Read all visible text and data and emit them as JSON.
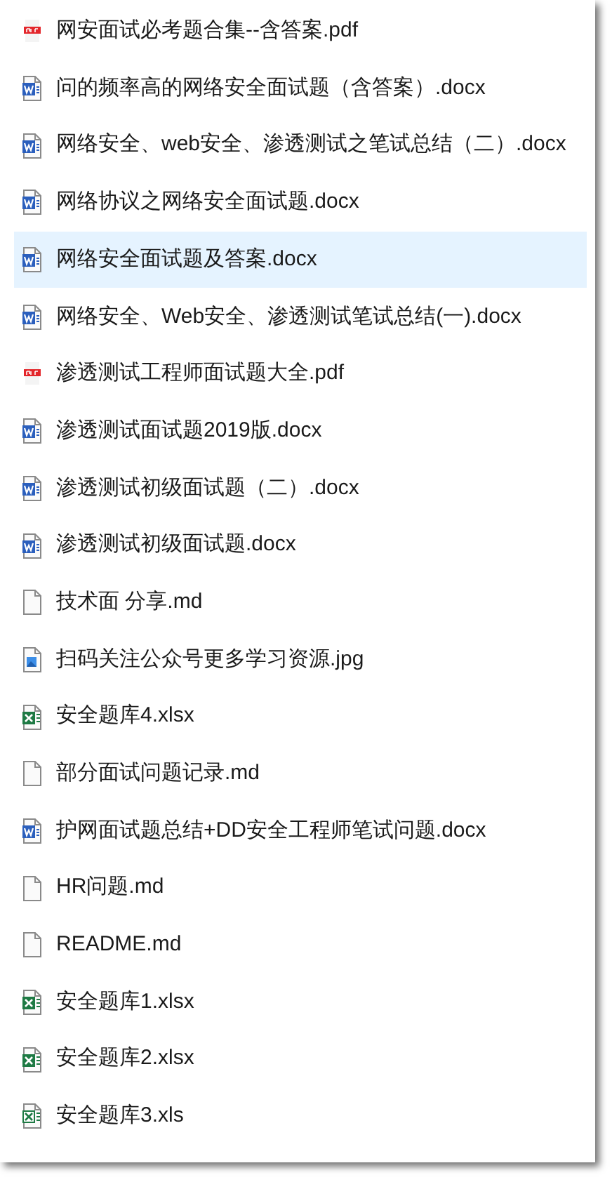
{
  "files": [
    {
      "name": "网安面试必考题合集--含答案.pdf",
      "kind": "pdf",
      "selected": false
    },
    {
      "name": "问的频率高的网络安全面试题（含答案）.docx",
      "kind": "word",
      "selected": false
    },
    {
      "name": "网络安全、web安全、渗透测试之笔试总结（二）.docx",
      "kind": "word",
      "selected": false
    },
    {
      "name": "网络协议之网络安全面试题.docx",
      "kind": "word",
      "selected": false
    },
    {
      "name": "网络安全面试题及答案.docx",
      "kind": "word",
      "selected": true
    },
    {
      "name": "网络安全、Web安全、渗透测试笔试总结(一).docx",
      "kind": "word",
      "selected": false
    },
    {
      "name": "渗透测试工程师面试题大全.pdf",
      "kind": "pdf",
      "selected": false
    },
    {
      "name": "渗透测试面试题2019版.docx",
      "kind": "word",
      "selected": false
    },
    {
      "name": "渗透测试初级面试题（二）.docx",
      "kind": "word",
      "selected": false
    },
    {
      "name": "渗透测试初级面试题.docx",
      "kind": "word",
      "selected": false
    },
    {
      "name": "技术面 分享.md",
      "kind": "text",
      "selected": false
    },
    {
      "name": "扫码关注公众号更多学习资源.jpg",
      "kind": "image",
      "selected": false
    },
    {
      "name": "安全题库4.xlsx",
      "kind": "excel",
      "selected": false
    },
    {
      "name": "部分面试问题记录.md",
      "kind": "text",
      "selected": false
    },
    {
      "name": "护网面试题总结+DD安全工程师笔试问题.docx",
      "kind": "word",
      "selected": false
    },
    {
      "name": "HR问题.md",
      "kind": "text",
      "selected": false
    },
    {
      "name": "README.md",
      "kind": "text",
      "selected": false
    },
    {
      "name": "安全题库1.xlsx",
      "kind": "excel",
      "selected": false
    },
    {
      "name": "安全题库2.xlsx",
      "kind": "excel",
      "selected": false
    },
    {
      "name": "安全题库3.xls",
      "kind": "excel-old",
      "selected": false
    }
  ]
}
